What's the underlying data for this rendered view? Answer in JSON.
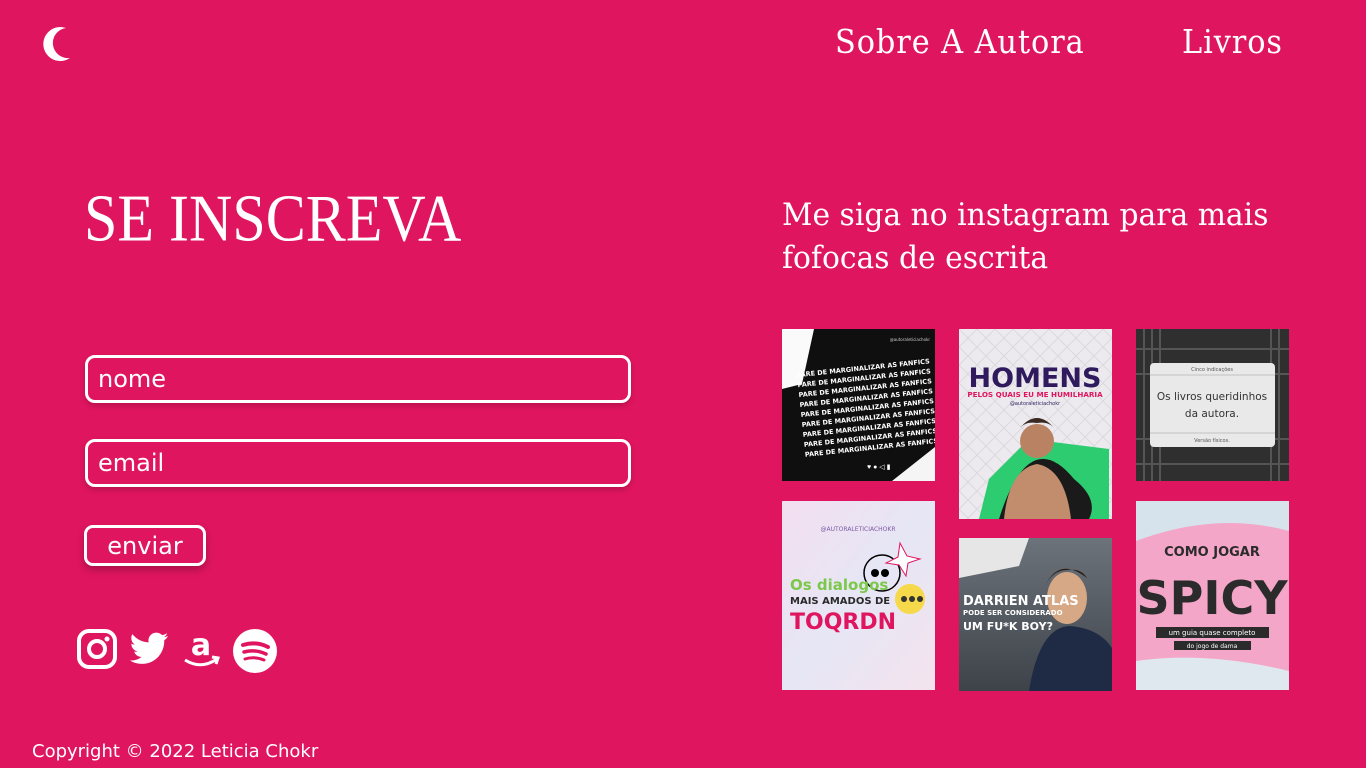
{
  "header": {
    "logo_icon": "crescent-moon-icon",
    "nav": [
      {
        "label": "Sobre A Autora"
      },
      {
        "label": "Livros"
      }
    ]
  },
  "signup": {
    "title": "SE INSCREVA",
    "name_placeholder": "nome",
    "email_placeholder": "email",
    "submit_label": "enviar"
  },
  "socials": [
    {
      "icon": "instagram-icon"
    },
    {
      "icon": "twitter-icon"
    },
    {
      "icon": "amazon-icon"
    },
    {
      "icon": "spotify-icon"
    }
  ],
  "instagram": {
    "title": "Me siga no instagram para mais fofocas de escrita",
    "posts": [
      {
        "handle": "@autoraleticiachokr",
        "text": "PARE DE MARGINALIZAR AS FANFICS"
      },
      {
        "title": "HOMENS",
        "subtitle": "PELOS QUAIS EU ME HUMILHARIA",
        "handle": "@autoraleticiachokr"
      },
      {
        "small_top": "Cinco indicações",
        "text_line1": "Os livros queridinhos",
        "text_line2": "da autora.",
        "small_bottom": "Versão físicos."
      },
      {
        "handle": "@AUTORALETICIACHOKR",
        "line1": "Os dialogos",
        "line2": "MAIS AMADOS DE",
        "line3": "TOQRDN"
      },
      {
        "line1": "DARRIEN ATLAS",
        "line2": "PODE SER CONSIDERADO",
        "line3": "UM FU*K BOY?"
      },
      {
        "line1": "COMO JOGAR",
        "line2": "SPICY",
        "line3": "um guia quase completo",
        "line4": "do jogo de dama"
      }
    ]
  },
  "footer": {
    "copyright": "Copyright © 2022 Leticia Chokr"
  },
  "colors": {
    "background": "#e0155f",
    "text": "#ffffff"
  }
}
